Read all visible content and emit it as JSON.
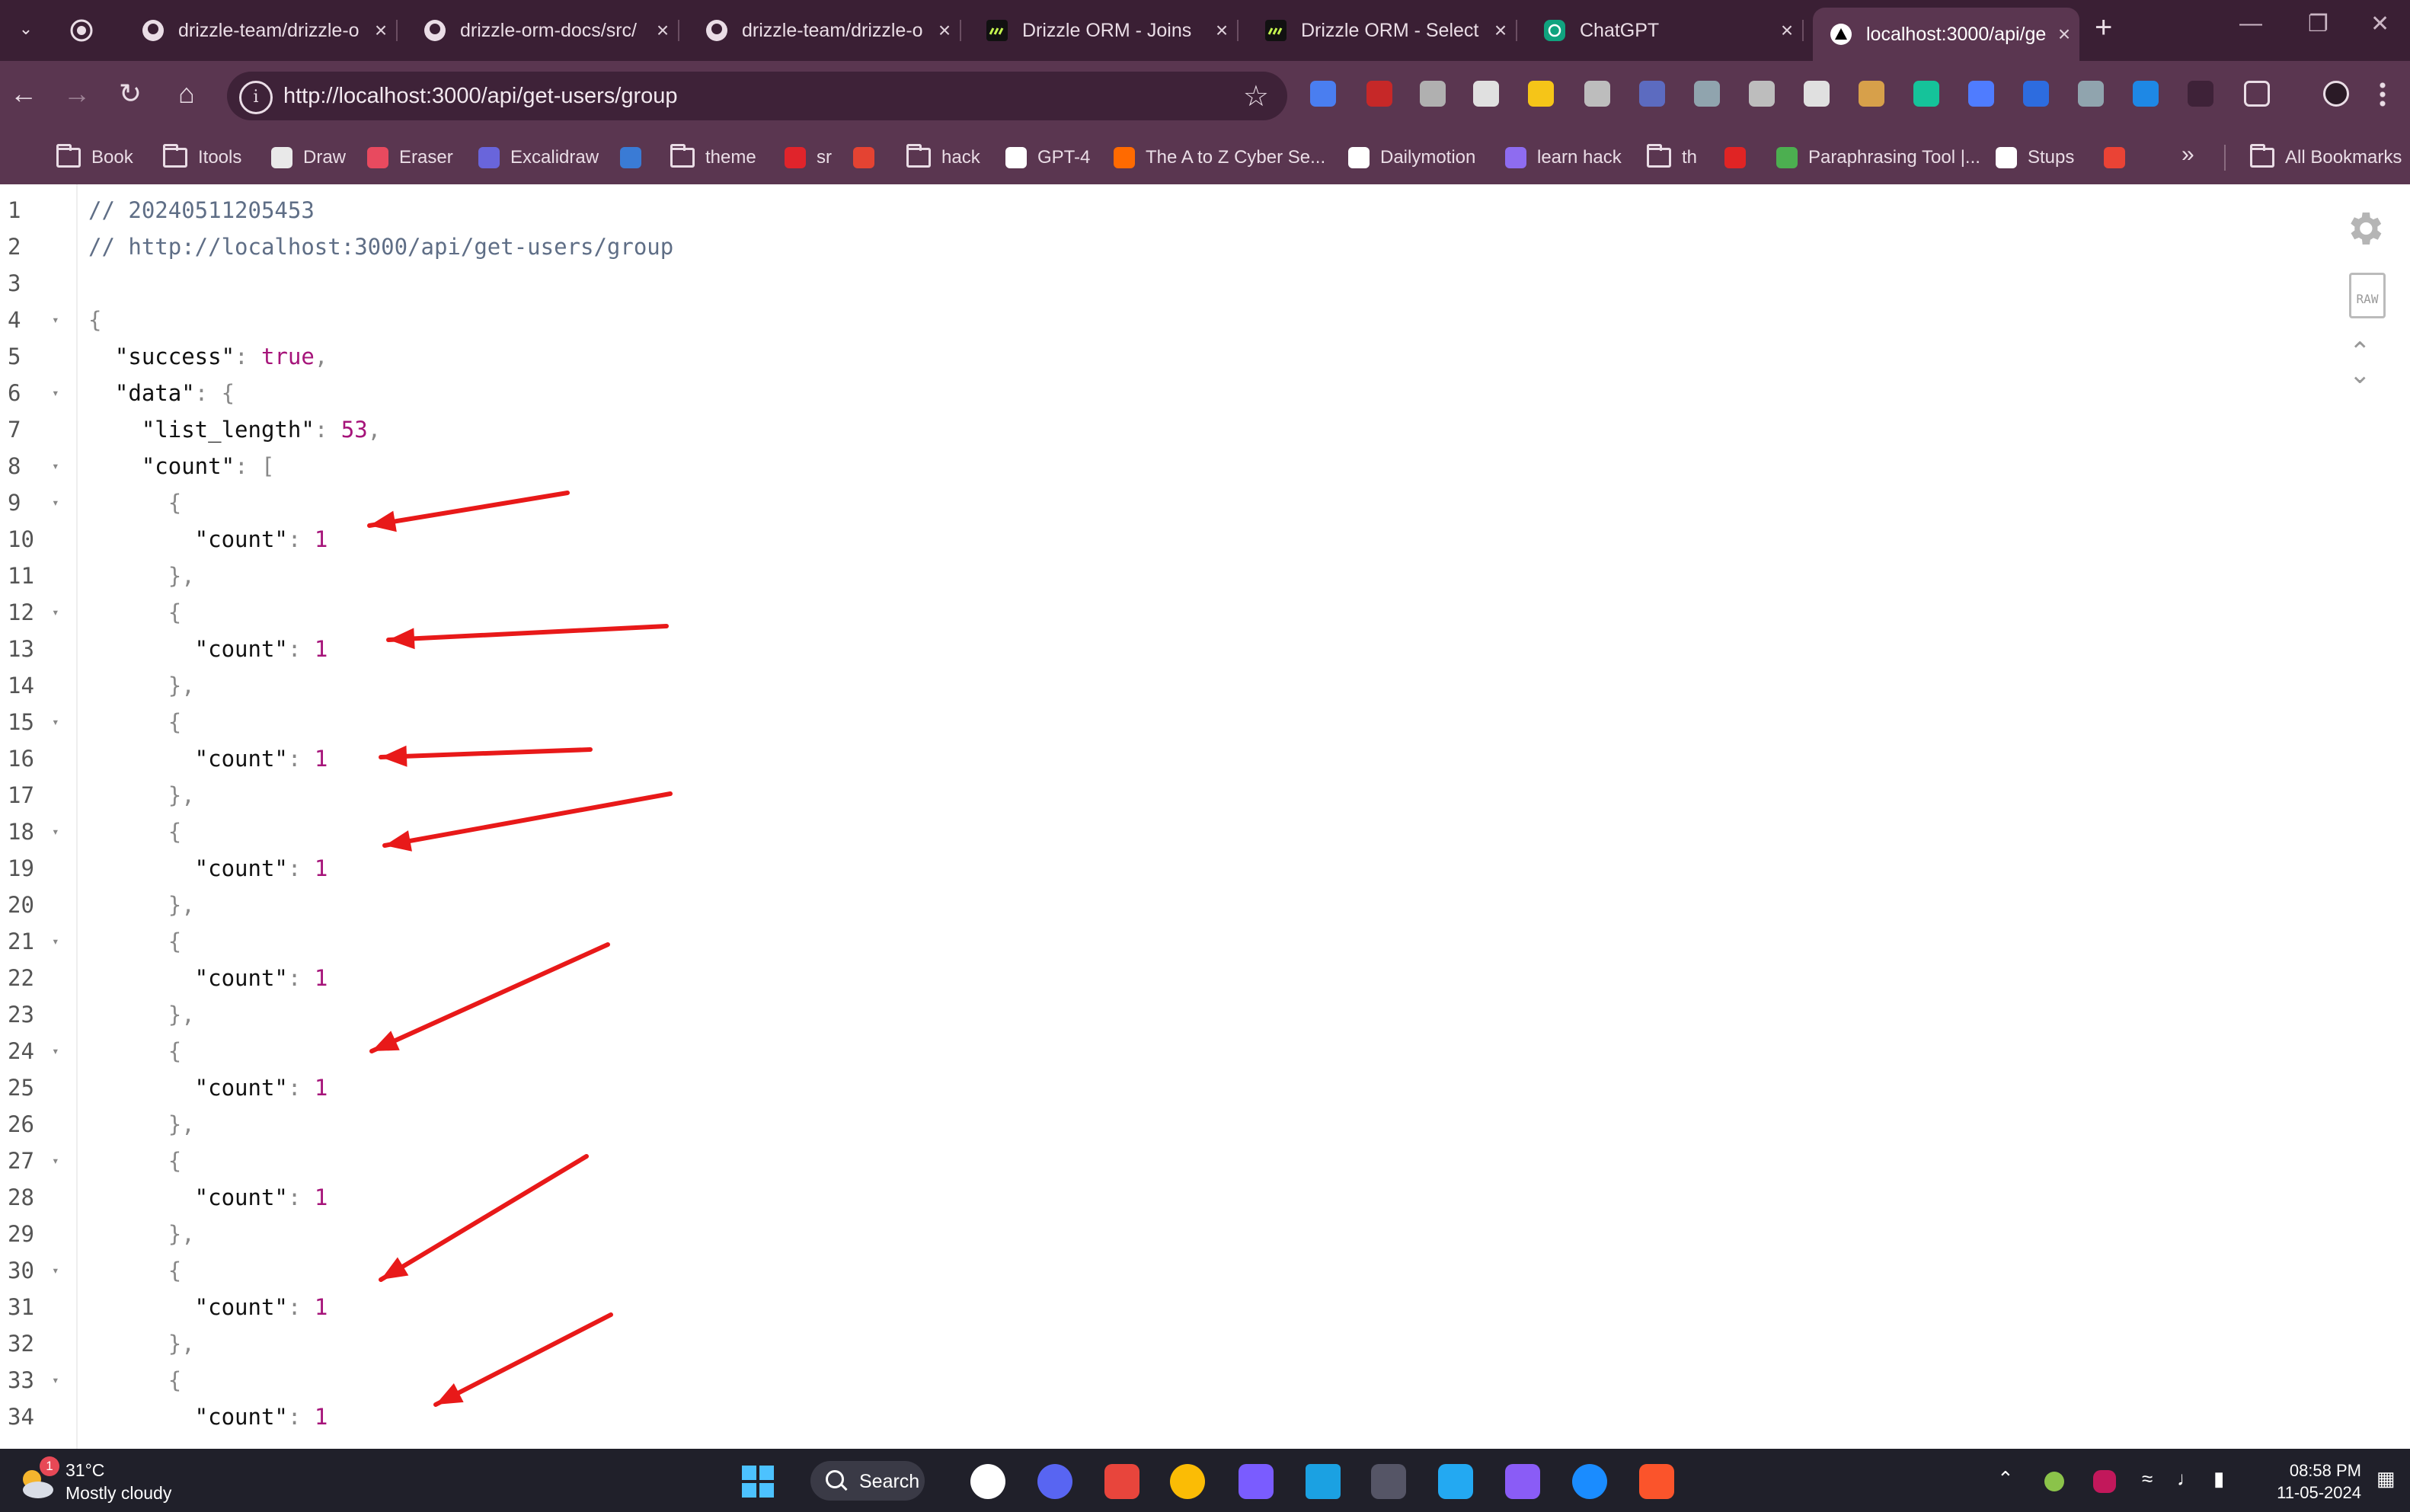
{
  "browser": {
    "tabs": [
      {
        "title": "",
        "icon": "whatsapp-icon",
        "color": "#25d366"
      },
      {
        "title": "drizzle-team/drizzle-o",
        "icon": "github-icon"
      },
      {
        "title": "drizzle-orm-docs/src/",
        "icon": "github-icon"
      },
      {
        "title": "drizzle-team/drizzle-o",
        "icon": "github-icon"
      },
      {
        "title": "Drizzle ORM - Joins",
        "icon": "drizzle-icon"
      },
      {
        "title": "Drizzle ORM - Select",
        "icon": "drizzle-icon"
      },
      {
        "title": "ChatGPT",
        "icon": "chatgpt-icon"
      },
      {
        "title": "localhost:3000/api/ge",
        "icon": "nextjs-icon",
        "active": true
      }
    ],
    "new_tab": "+",
    "url": "http://localhost:3000/api/get-users/group",
    "bookmarks": [
      {
        "label": "Book",
        "type": "folder"
      },
      {
        "label": "Itools",
        "type": "folder"
      },
      {
        "label": "Draw",
        "type": "site",
        "color": "#e9e9e9"
      },
      {
        "label": "Eraser",
        "type": "site",
        "color": "#e84a5f"
      },
      {
        "label": "Excalidraw",
        "type": "site",
        "color": "#6965db"
      },
      {
        "label": "",
        "type": "site",
        "color": "#3a7bd5"
      },
      {
        "label": "theme",
        "type": "folder"
      },
      {
        "label": "sr",
        "type": "site",
        "color": "#e0242b"
      },
      {
        "label": "",
        "type": "site",
        "color": "#e44332"
      },
      {
        "label": "hack",
        "type": "folder"
      },
      {
        "label": "GPT-4",
        "type": "site",
        "color": "#ffffff"
      },
      {
        "label": "The A to Z Cyber Se...",
        "type": "site",
        "color": "#ff6a00"
      },
      {
        "label": "Dailymotion",
        "type": "site",
        "color": "#ffffff"
      },
      {
        "label": "learn hack",
        "type": "site",
        "color": "#8e6cf0"
      },
      {
        "label": "th",
        "type": "folder"
      },
      {
        "label": "",
        "type": "site",
        "color": "#e02424"
      },
      {
        "label": "Paraphrasing Tool |...",
        "type": "site",
        "color": "#4caf50"
      },
      {
        "label": "Stups",
        "type": "site",
        "color": "#ffffff"
      },
      {
        "label": "",
        "type": "site",
        "color": "#ea4335"
      }
    ],
    "more_bookmarks": "»",
    "all_bookmarks": "All Bookmarks"
  },
  "json_viewer": {
    "raw_label": "RAW",
    "lines": [
      {
        "n": "1",
        "fold": false,
        "parts": [
          {
            "t": "// 20240511205453",
            "c": "cm"
          }
        ]
      },
      {
        "n": "2",
        "fold": false,
        "parts": [
          {
            "t": "// http://localhost:3000/api/get-users/group",
            "c": "cm"
          }
        ]
      },
      {
        "n": "3",
        "fold": false,
        "parts": []
      },
      {
        "n": "4",
        "fold": true,
        "parts": [
          {
            "t": "{",
            "c": "p"
          }
        ]
      },
      {
        "n": "5",
        "fold": false,
        "parts": [
          {
            "t": "  \"success\"",
            "c": "k"
          },
          {
            "t": ": ",
            "c": "p"
          },
          {
            "t": "true",
            "c": "b"
          },
          {
            "t": ",",
            "c": "p"
          }
        ]
      },
      {
        "n": "6",
        "fold": true,
        "parts": [
          {
            "t": "  \"data\"",
            "c": "k"
          },
          {
            "t": ": {",
            "c": "p"
          }
        ]
      },
      {
        "n": "7",
        "fold": false,
        "parts": [
          {
            "t": "    \"list_length\"",
            "c": "k"
          },
          {
            "t": ": ",
            "c": "p"
          },
          {
            "t": "53",
            "c": "n"
          },
          {
            "t": ",",
            "c": "p"
          }
        ]
      },
      {
        "n": "8",
        "fold": true,
        "parts": [
          {
            "t": "    \"count\"",
            "c": "k"
          },
          {
            "t": ": [",
            "c": "p"
          }
        ]
      },
      {
        "n": "9",
        "fold": true,
        "parts": [
          {
            "t": "      {",
            "c": "p"
          }
        ]
      },
      {
        "n": "10",
        "fold": false,
        "parts": [
          {
            "t": "        \"count\"",
            "c": "k"
          },
          {
            "t": ": ",
            "c": "p"
          },
          {
            "t": "1",
            "c": "n"
          }
        ]
      },
      {
        "n": "11",
        "fold": false,
        "parts": [
          {
            "t": "      },",
            "c": "p"
          }
        ]
      },
      {
        "n": "12",
        "fold": true,
        "parts": [
          {
            "t": "      {",
            "c": "p"
          }
        ]
      },
      {
        "n": "13",
        "fold": false,
        "parts": [
          {
            "t": "        \"count\"",
            "c": "k"
          },
          {
            "t": ": ",
            "c": "p"
          },
          {
            "t": "1",
            "c": "n"
          }
        ]
      },
      {
        "n": "14",
        "fold": false,
        "parts": [
          {
            "t": "      },",
            "c": "p"
          }
        ]
      },
      {
        "n": "15",
        "fold": true,
        "parts": [
          {
            "t": "      {",
            "c": "p"
          }
        ]
      },
      {
        "n": "16",
        "fold": false,
        "parts": [
          {
            "t": "        \"count\"",
            "c": "k"
          },
          {
            "t": ": ",
            "c": "p"
          },
          {
            "t": "1",
            "c": "n"
          }
        ]
      },
      {
        "n": "17",
        "fold": false,
        "parts": [
          {
            "t": "      },",
            "c": "p"
          }
        ]
      },
      {
        "n": "18",
        "fold": true,
        "parts": [
          {
            "t": "      {",
            "c": "p"
          }
        ]
      },
      {
        "n": "19",
        "fold": false,
        "parts": [
          {
            "t": "        \"count\"",
            "c": "k"
          },
          {
            "t": ": ",
            "c": "p"
          },
          {
            "t": "1",
            "c": "n"
          }
        ]
      },
      {
        "n": "20",
        "fold": false,
        "parts": [
          {
            "t": "      },",
            "c": "p"
          }
        ]
      },
      {
        "n": "21",
        "fold": true,
        "parts": [
          {
            "t": "      {",
            "c": "p"
          }
        ]
      },
      {
        "n": "22",
        "fold": false,
        "parts": [
          {
            "t": "        \"count\"",
            "c": "k"
          },
          {
            "t": ": ",
            "c": "p"
          },
          {
            "t": "1",
            "c": "n"
          }
        ]
      },
      {
        "n": "23",
        "fold": false,
        "parts": [
          {
            "t": "      },",
            "c": "p"
          }
        ]
      },
      {
        "n": "24",
        "fold": true,
        "parts": [
          {
            "t": "      {",
            "c": "p"
          }
        ]
      },
      {
        "n": "25",
        "fold": false,
        "parts": [
          {
            "t": "        \"count\"",
            "c": "k"
          },
          {
            "t": ": ",
            "c": "p"
          },
          {
            "t": "1",
            "c": "n"
          }
        ]
      },
      {
        "n": "26",
        "fold": false,
        "parts": [
          {
            "t": "      },",
            "c": "p"
          }
        ]
      },
      {
        "n": "27",
        "fold": true,
        "parts": [
          {
            "t": "      {",
            "c": "p"
          }
        ]
      },
      {
        "n": "28",
        "fold": false,
        "parts": [
          {
            "t": "        \"count\"",
            "c": "k"
          },
          {
            "t": ": ",
            "c": "p"
          },
          {
            "t": "1",
            "c": "n"
          }
        ]
      },
      {
        "n": "29",
        "fold": false,
        "parts": [
          {
            "t": "      },",
            "c": "p"
          }
        ]
      },
      {
        "n": "30",
        "fold": true,
        "parts": [
          {
            "t": "      {",
            "c": "p"
          }
        ]
      },
      {
        "n": "31",
        "fold": false,
        "parts": [
          {
            "t": "        \"count\"",
            "c": "k"
          },
          {
            "t": ": ",
            "c": "p"
          },
          {
            "t": "1",
            "c": "n"
          }
        ]
      },
      {
        "n": "32",
        "fold": false,
        "parts": [
          {
            "t": "      },",
            "c": "p"
          }
        ]
      },
      {
        "n": "33",
        "fold": true,
        "parts": [
          {
            "t": "      {",
            "c": "p"
          }
        ]
      },
      {
        "n": "34",
        "fold": false,
        "parts": [
          {
            "t": "        \"count\"",
            "c": "k"
          },
          {
            "t": ": ",
            "c": "p"
          },
          {
            "t": "1",
            "c": "n"
          }
        ]
      }
    ],
    "annotation_color": "#e81919",
    "annotation_arrows_points_to_lines": [
      "10",
      "13",
      "16",
      "19",
      "24",
      "30",
      "34"
    ]
  },
  "taskbar": {
    "weather_temp": "31°C",
    "weather_desc": "Mostly cloudy",
    "weather_badge": "1",
    "search_label": "Search",
    "time": "08:58 PM",
    "date": "11-05-2024"
  }
}
